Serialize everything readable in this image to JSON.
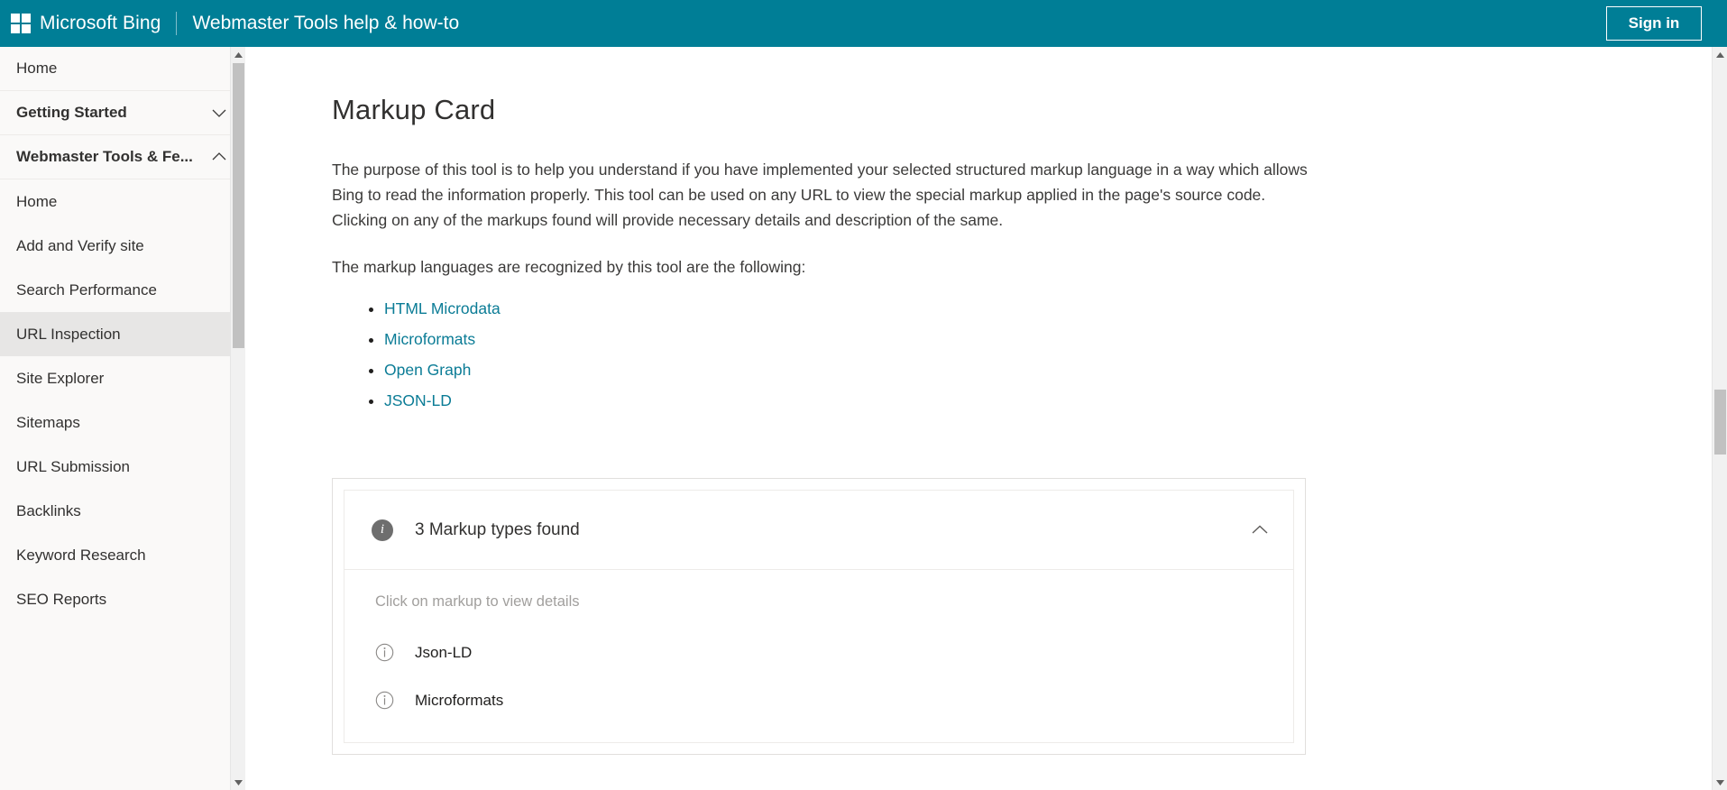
{
  "header": {
    "logo_icon": "microsoft-squares-logo",
    "brand": "Microsoft Bing",
    "site_title": "Webmaster Tools help & how-to",
    "signin_label": "Sign in",
    "background_color": "#007e96"
  },
  "sidebar": {
    "items": [
      {
        "label": "Home",
        "type": "link",
        "selected": false
      },
      {
        "label": "Getting Started",
        "type": "group",
        "expanded": false,
        "icon": "chevron-down-icon",
        "selected": false
      },
      {
        "label": "Webmaster Tools & Fe...",
        "type": "group",
        "expanded": true,
        "icon": "chevron-up-icon",
        "selected": false
      },
      {
        "label": "Home",
        "type": "sub",
        "selected": false
      },
      {
        "label": "Add and Verify site",
        "type": "sub",
        "selected": false
      },
      {
        "label": "Search Performance",
        "type": "sub",
        "selected": false
      },
      {
        "label": "URL Inspection",
        "type": "sub",
        "selected": true
      },
      {
        "label": "Site Explorer",
        "type": "sub",
        "selected": false
      },
      {
        "label": "Sitemaps",
        "type": "sub",
        "selected": false
      },
      {
        "label": "URL Submission",
        "type": "sub",
        "selected": false
      },
      {
        "label": "Backlinks",
        "type": "sub",
        "selected": false
      },
      {
        "label": "Keyword Research",
        "type": "sub",
        "selected": false
      },
      {
        "label": "SEO Reports",
        "type": "sub",
        "selected": false
      }
    ],
    "scrollbar": {
      "up_icon": "scroll-up-arrow-icon",
      "down_icon": "scroll-down-arrow-icon"
    }
  },
  "main": {
    "title": "Markup Card",
    "paragraph_1": "The purpose of this tool is to help you understand if you have implemented your selected structured markup language in a way which allows Bing to read the information properly. This tool can be used on any URL to view the special markup applied in the page's source code. Clicking on any of the markups found will provide necessary details and description of the same.",
    "paragraph_2": "The markup languages are recognized by this tool are the following:",
    "link_color": "#0b7c96",
    "markup_links": [
      {
        "label": "HTML Microdata"
      },
      {
        "label": "Microformats"
      },
      {
        "label": "Open Graph"
      },
      {
        "label": "JSON-LD"
      }
    ],
    "card": {
      "info_icon": "info-filled-icon",
      "heading": "3 Markup types found",
      "collapse_icon": "chevron-up-icon",
      "hint": "Click on markup to view details",
      "rows": [
        {
          "icon": "info-outline-icon",
          "label": "Json-LD"
        },
        {
          "icon": "info-outline-icon",
          "label": "Microformats"
        }
      ]
    }
  }
}
